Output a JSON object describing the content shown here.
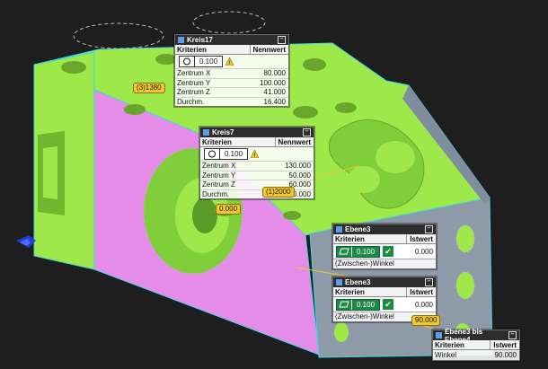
{
  "panels": {
    "kreis17": {
      "title": "Kreis17",
      "col_criteria": "Kriterien",
      "col_value": "Nennwert",
      "tolerance": "0.100",
      "rows": [
        {
          "label": "Zentrum X",
          "value": "80.000"
        },
        {
          "label": "Zentrum Y",
          "value": "100.000"
        },
        {
          "label": "Zentrum Z",
          "value": "41.000"
        },
        {
          "label": "Durchm.",
          "value": "16.400"
        }
      ]
    },
    "kreis7": {
      "title": "Kreis7",
      "col_criteria": "Kriterien",
      "col_value": "Nennwert",
      "tolerance": "0.100",
      "rows": [
        {
          "label": "Zentrum X",
          "value": "130.000"
        },
        {
          "label": "Zentrum Y",
          "value": "50.000"
        },
        {
          "label": "Zentrum Z",
          "value": "60.000"
        },
        {
          "label": "Durchm.",
          "value": "40.000"
        }
      ]
    },
    "ebene3a": {
      "title": "Ebene3",
      "col_criteria": "Kriterien",
      "col_value": "Istwert",
      "tolerance": "0.100",
      "measured": "0.000",
      "sub_label": "(Zwischen-)Winkel"
    },
    "ebene3b": {
      "title": "Ebene3",
      "col_criteria": "Kriterien",
      "col_value": "Istwert",
      "tolerance": "0.100",
      "measured": "0.000",
      "sub_label": "(Zwischen-)Winkel"
    },
    "ebene34": {
      "title": "Ebene3 bis Ebene4",
      "col_criteria": "Kriterien",
      "col_value": "Istwert",
      "rows": [
        {
          "label": "Winkel",
          "value": "90.000"
        }
      ]
    }
  },
  "tags": {
    "t31380": "(3)1380",
    "t12000": "(1)2000",
    "t0000": "0.000",
    "t90000": "90.000"
  },
  "colors": {
    "background": "#1e1e1e",
    "green_face": "#9fe84a",
    "magenta_face": "#e58be8",
    "grey_face": "#8f9aa8",
    "edge_cyan": "#3fd6e6",
    "tag_yellow": "#f2c630",
    "ok_green": "#1d8a45"
  },
  "icons": [
    "panel-feature-icon",
    "circle-symbol-icon",
    "flatness-symbol-icon",
    "warning-icon",
    "check-icon",
    "minimize-icon",
    "axis-triad-icon"
  ]
}
